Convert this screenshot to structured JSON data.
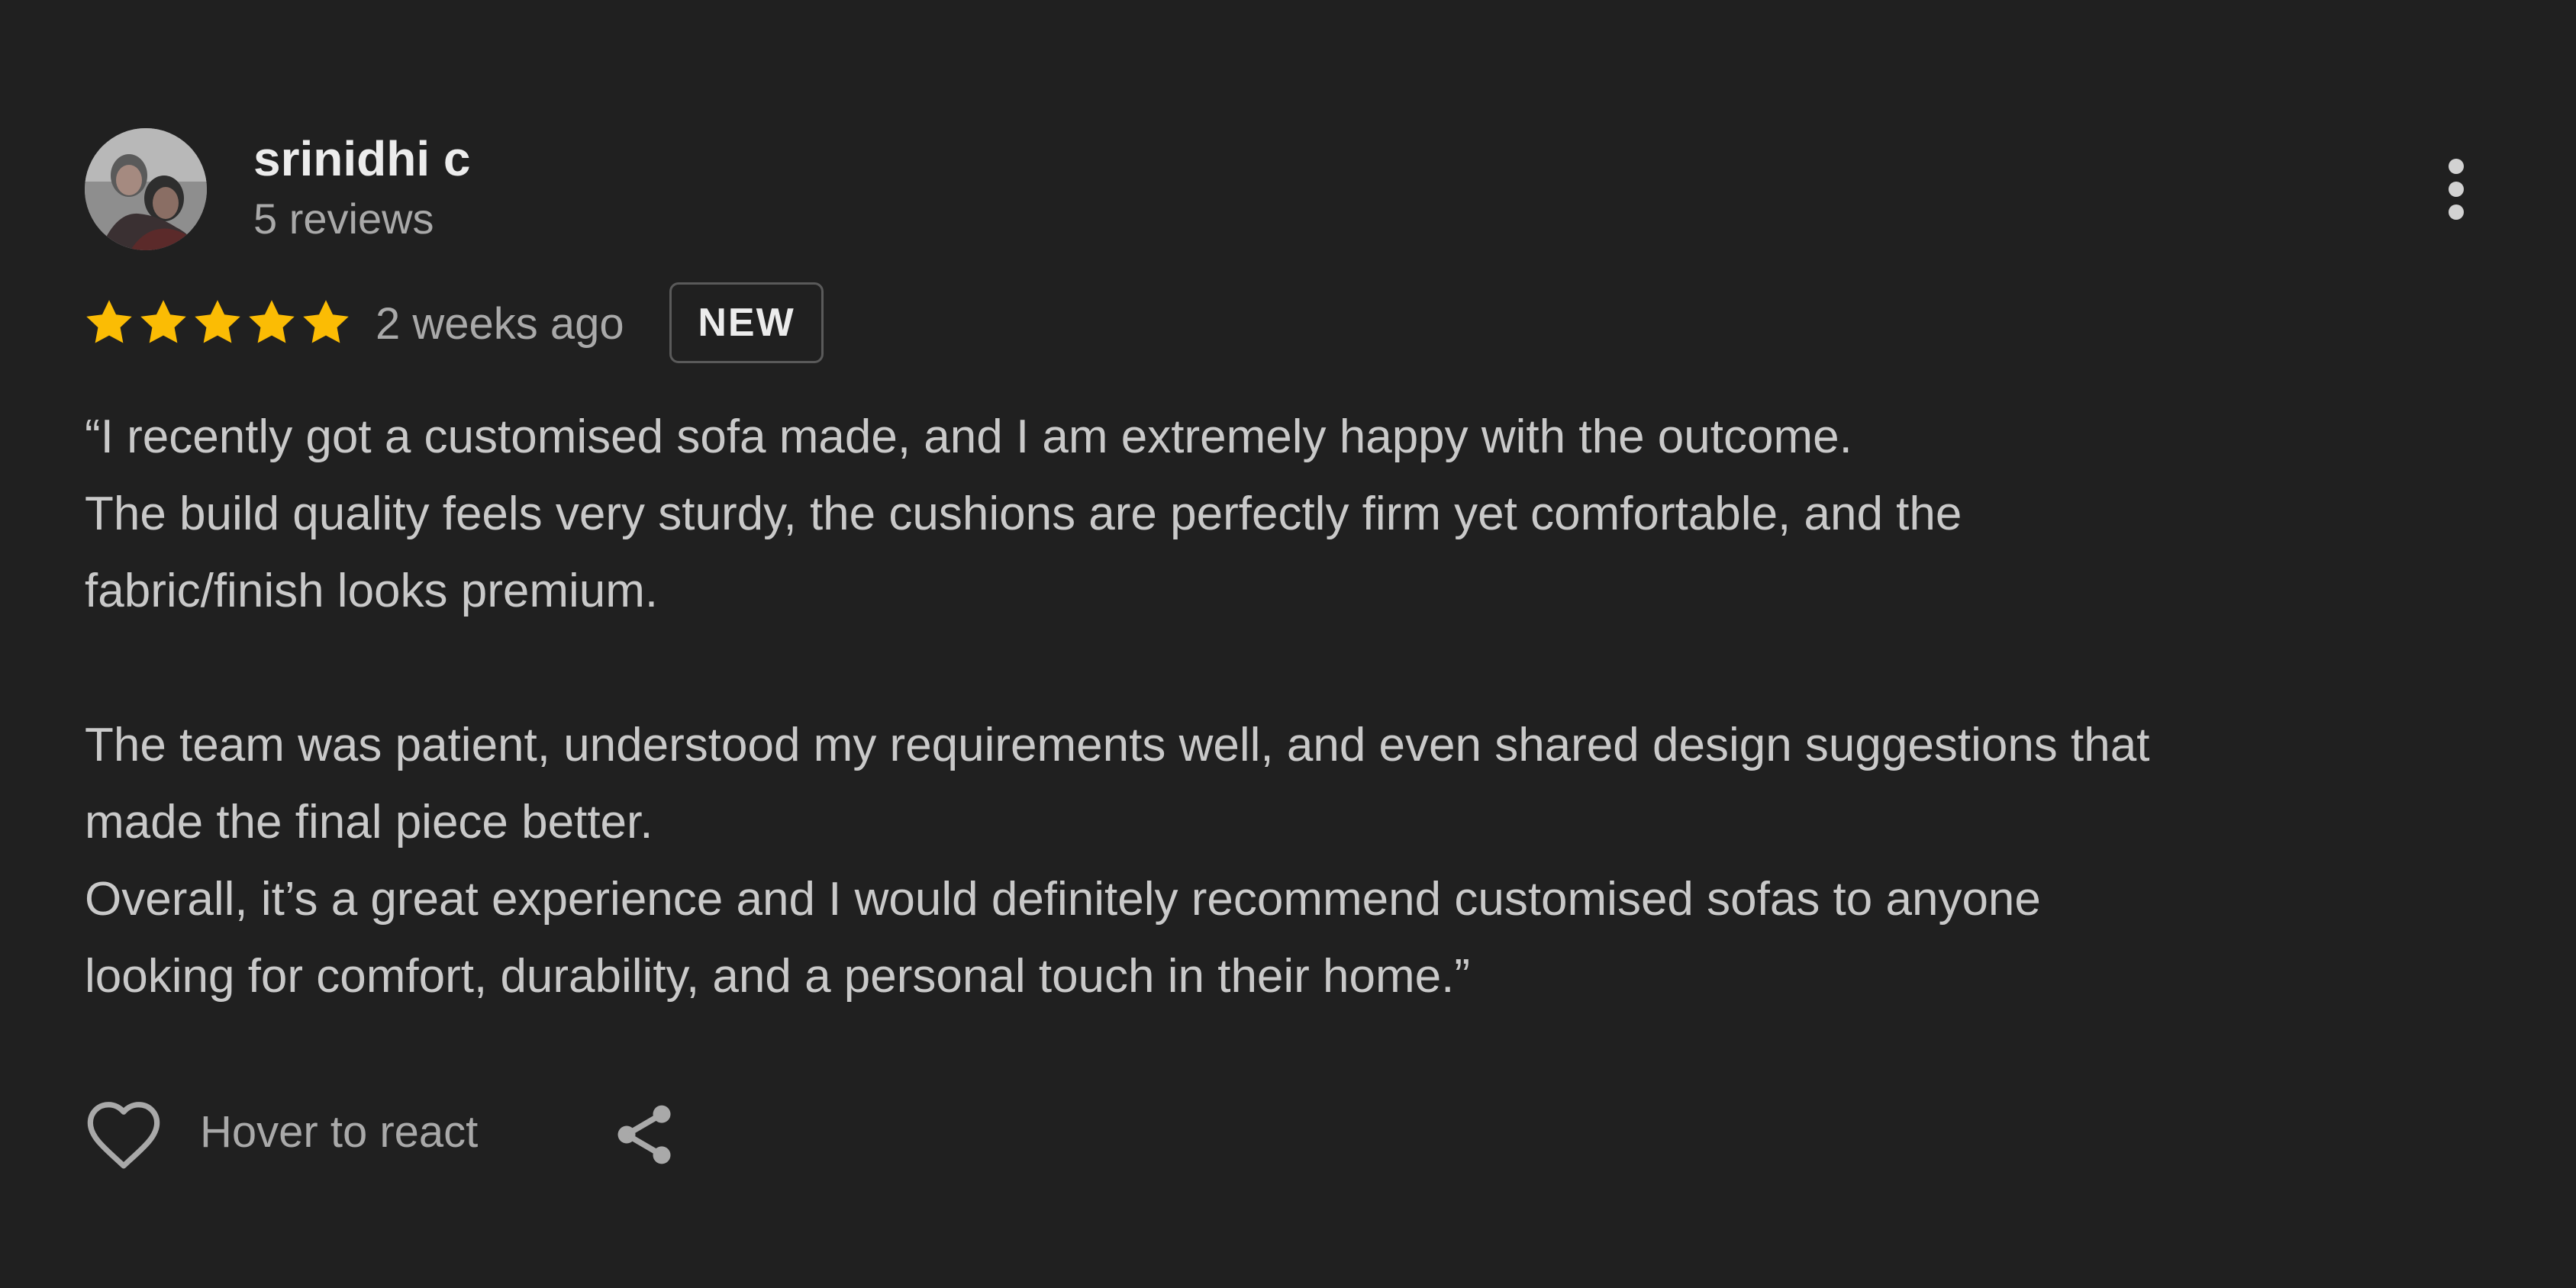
{
  "review": {
    "author": {
      "name": "srinidhi c",
      "review_count": "5 reviews"
    },
    "rating": 5,
    "rating_max": 5,
    "date": "2 weeks ago",
    "badge": "NEW",
    "text_lines": [
      "“I recently got a customised sofa made, and I am extremely happy with the outcome.",
      "The build quality feels very sturdy, the cushions are perfectly firm yet comfortable, and the",
      "fabric/finish looks premium.",
      "",
      "The team was patient, understood my requirements well, and even shared design suggestions that",
      "made the final piece better.",
      "Overall, it’s a great experience and I would definitely recommend customised sofas to anyone",
      "looking for comfort, durability, and a personal touch in their home.”"
    ]
  },
  "actions": {
    "react_label": "Hover to react"
  },
  "icons": {
    "more": "more-vertical-icon",
    "star": "star-icon",
    "heart": "heart-outline-icon",
    "share": "share-icon"
  },
  "colors": {
    "background": "#202020",
    "star": "#fbbc04",
    "primary_text": "#ececec",
    "secondary_text": "#a9a9a9",
    "body_text": "#c9c9c9"
  }
}
